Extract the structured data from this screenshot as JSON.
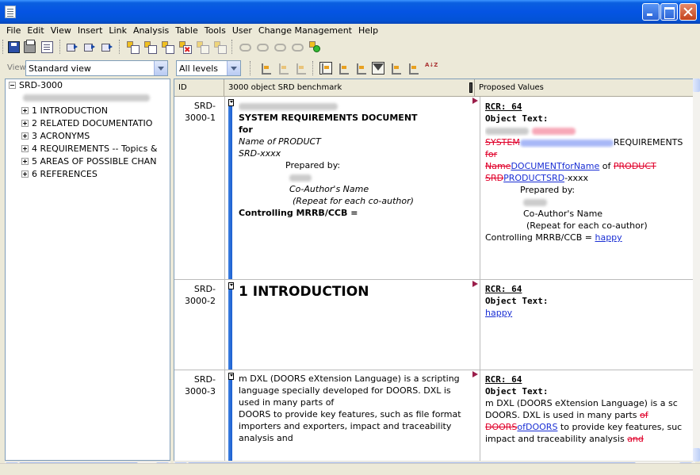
{
  "menu": [
    "File",
    "Edit",
    "View",
    "Insert",
    "Link",
    "Analysis",
    "Table",
    "Tools",
    "User",
    "Change Management",
    "Help"
  ],
  "viewbar": {
    "view_label": "View",
    "view_value": "Standard view",
    "levels_value": "All levels"
  },
  "tree": {
    "root": "SRD-3000",
    "items": [
      "1 INTRODUCTION",
      "2 RELATED DOCUMENTATIO",
      "3 ACRONYMS",
      "4 REQUIREMENTS -- Topics &",
      "5 AREAS OF POSSIBLE CHAN",
      "6 REFERENCES"
    ]
  },
  "grid": {
    "headers": [
      "ID",
      "3000 object SRD benchmark",
      "Proposed Values"
    ],
    "rows": [
      {
        "id_line1": "SRD-",
        "id_line2": "3000-1",
        "obj": {
          "title": "SYSTEM REQUIREMENTS DOCUMENT",
          "for": "for",
          "product": "Name of PRODUCT",
          "srd": "SRD-xxxx",
          "prepared": "Prepared by:",
          "coauthor": "Co-Author's Name",
          "repeat": "(Repeat for each co-author)",
          "controlling": "Controlling MRRB/CCB ="
        },
        "prop": {
          "rcr": "RCR: 64",
          "objtext": "Object Text:",
          "l3_del": "SYSTEM",
          "l3_rest": "REQUIREMENTS",
          "l4_del": "for",
          "l5_del1": "Name",
          "l5_ins": "DOCUMENTforName",
          "l5_mid": " of ",
          "l5_del2": "PRODUCT",
          "l6_del": "SRD",
          "l6_ins": "PRODUCTSRD",
          "l6_rest": "-xxxx",
          "prepared": "Prepared by:",
          "coauthor": "Co-Author's Name",
          "repeat": "(Repeat for each co-author)",
          "controlling": "Controlling MRRB/CCB = ",
          "happy": "  happy"
        }
      },
      {
        "id_line1": "SRD-",
        "id_line2": "3000-2",
        "obj": {
          "heading": "1 INTRODUCTION"
        },
        "prop": {
          "rcr": "RCR: 64",
          "objtext": "Object Text:",
          "happy": "  happy"
        }
      },
      {
        "id_line1": "SRD-",
        "id_line2": "3000-3",
        "obj": {
          "l1": "m  DXL (DOORS eXtension Language) is a scripting",
          "l2": "language specially developed for DOORS. DXL is",
          "l3": "used in many parts of",
          "l4": "DOORS to provide key features, such as file format",
          "l5": "importers and exporters, impact and traceability",
          "l6": "analysis and"
        },
        "prop": {
          "rcr": "RCR: 64",
          "objtext": "Object Text:",
          "l3": "m  DXL (DOORS eXtension Language) is a sc",
          "l4_a": "DOORS. DXL is used in many parts ",
          "l4_del": "of",
          "l5_del": "DOORS",
          "l5_ins": "ofDOORS",
          "l5_rest": " to provide key features, suc",
          "l6_a": "impact and traceability analysis ",
          "l6_del": "and"
        }
      }
    ]
  }
}
